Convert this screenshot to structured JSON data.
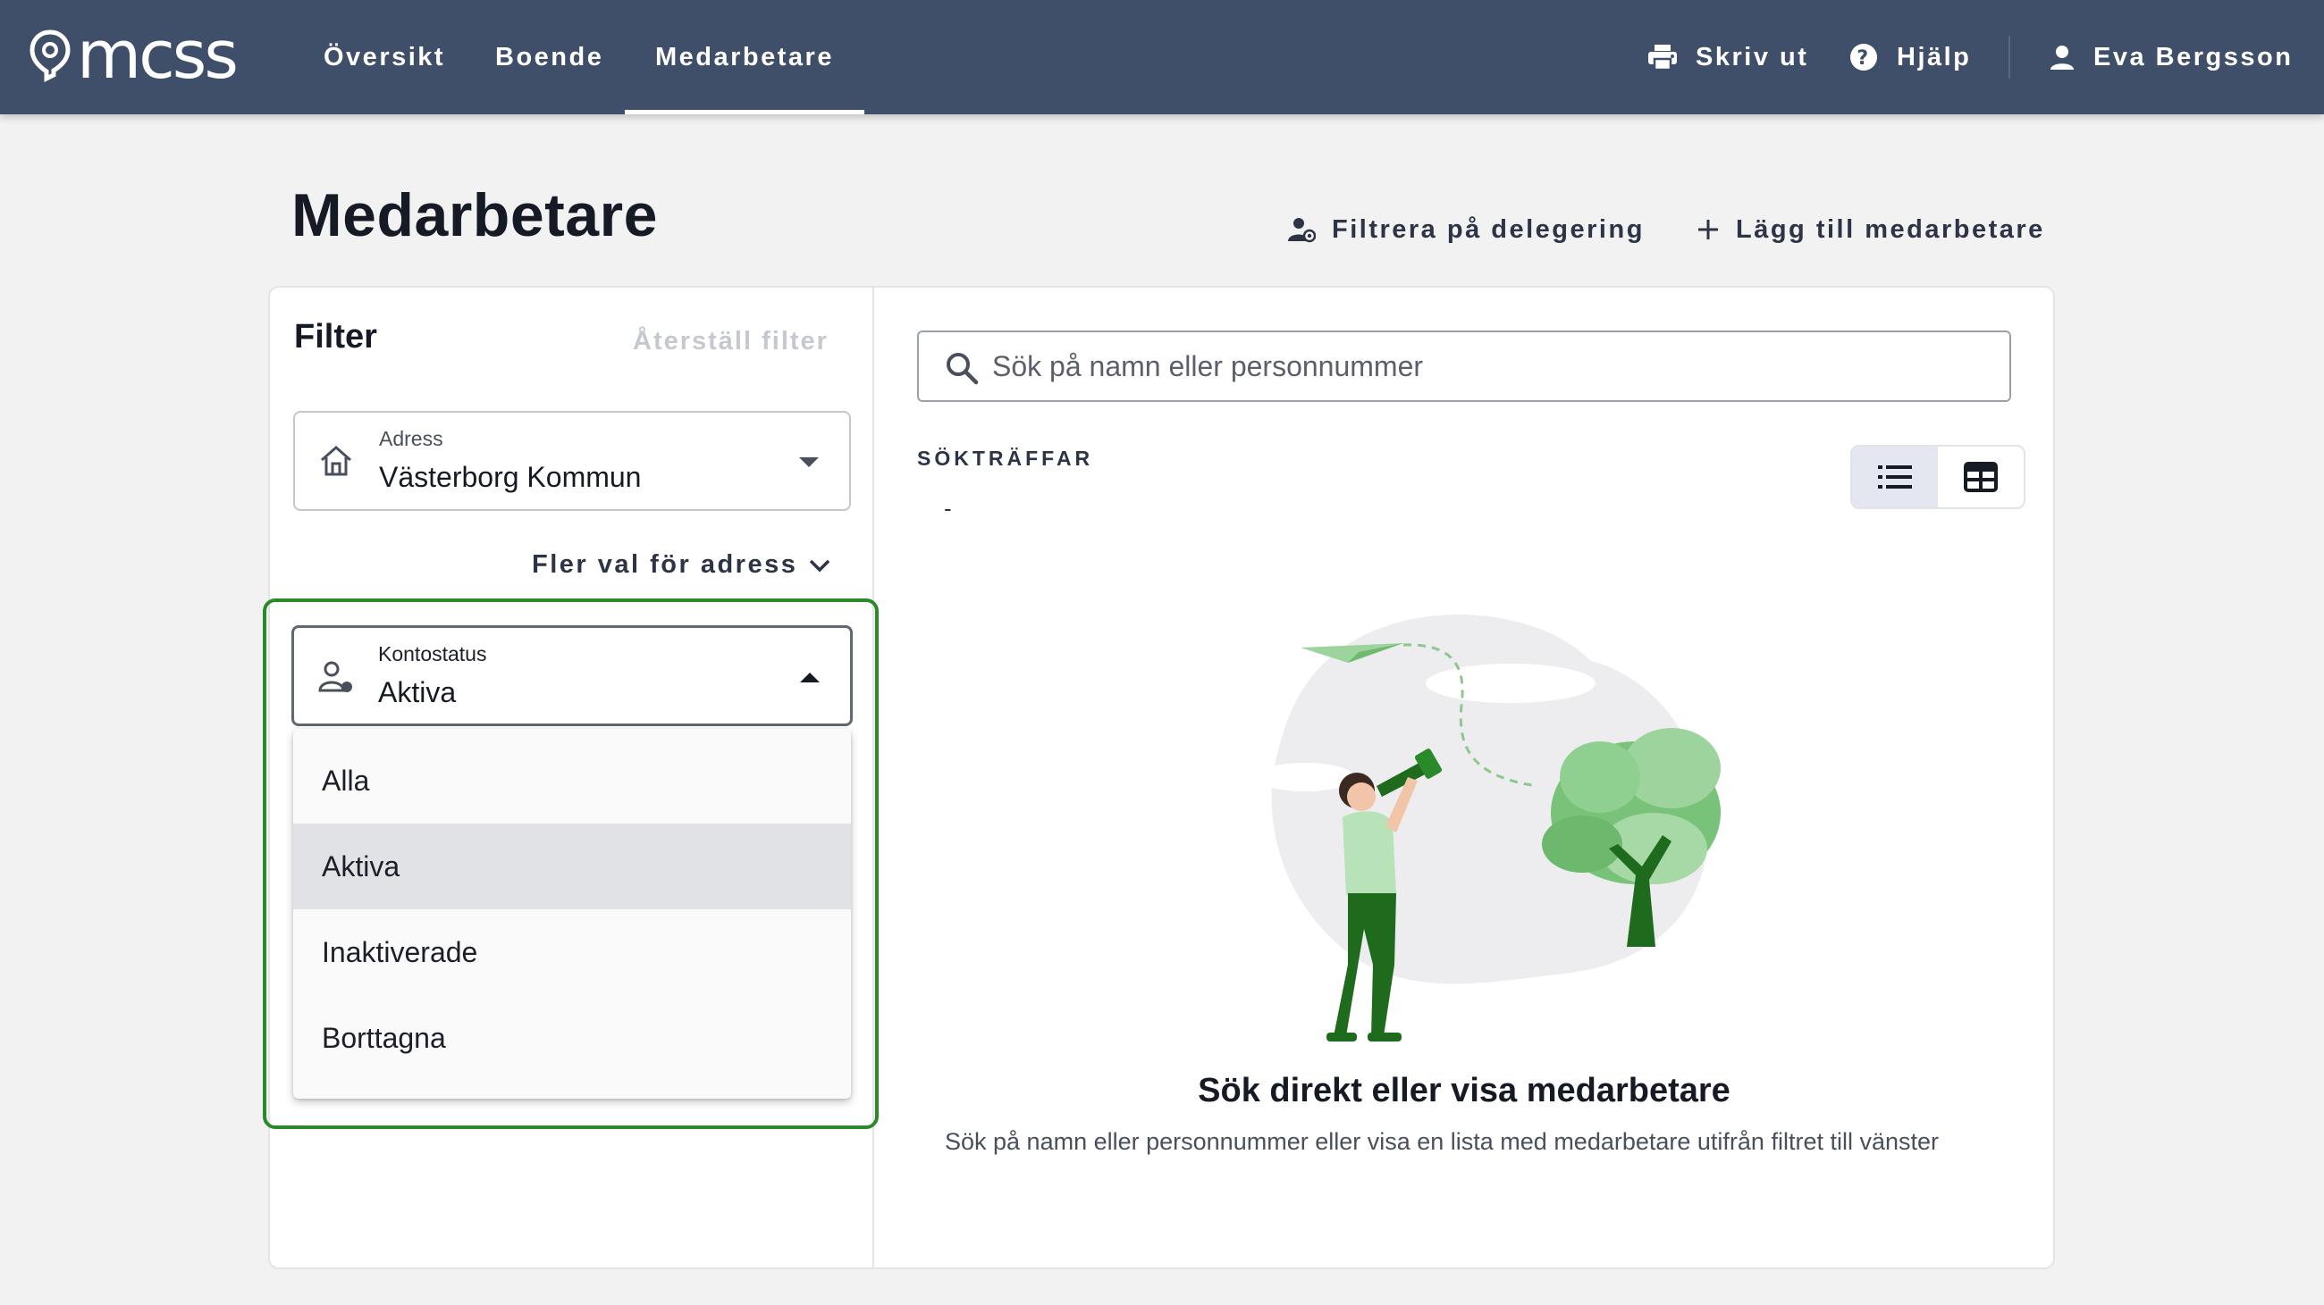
{
  "app": {
    "logo_text": "mcss",
    "nav": [
      {
        "label": "Översikt",
        "active": false
      },
      {
        "label": "Boende",
        "active": false
      },
      {
        "label": "Medarbetare",
        "active": true
      }
    ],
    "actions": {
      "print_label": "Skriv ut",
      "help_label": "Hjälp",
      "user_name": "Eva Bergsson"
    }
  },
  "page": {
    "title": "Medarbetare",
    "filter_delegation_label": "Filtrera på delegering",
    "add_employee_label": "Lägg till medarbetare"
  },
  "filter": {
    "title": "Filter",
    "reset_label": "Återställ filter",
    "address": {
      "label": "Adress",
      "value": "Västerborg Kommun"
    },
    "more_address_label": "Fler val för adress",
    "account_status": {
      "label": "Kontostatus",
      "value": "Aktiva",
      "options": [
        "Alla",
        "Aktiva",
        "Inaktiverade",
        "Borttagna"
      ],
      "selected": "Aktiva"
    }
  },
  "results": {
    "search_placeholder": "Sök på namn eller personnummer",
    "results_label": "SÖKTRÄFFAR",
    "results_value": "-",
    "view_mode": "list"
  },
  "empty_state": {
    "title": "Sök direkt eller visa medarbetare",
    "description": "Sök på namn eller personnummer eller visa en lista med medarbetare utifrån filtret till vänster"
  },
  "colors": {
    "topbar": "#3f4e69",
    "highlight": "#2a8a2a",
    "illustration_green": "#1e6b1e"
  }
}
